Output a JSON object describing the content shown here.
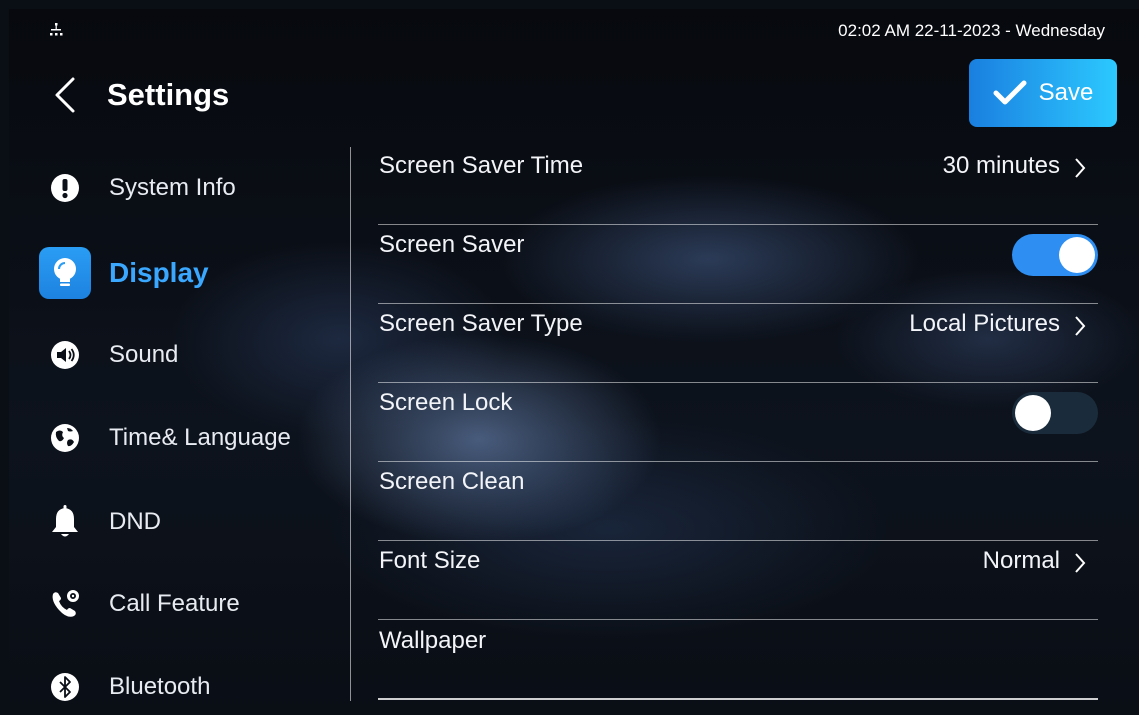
{
  "status_bar": {
    "datetime": "02:02 AM  22-11-2023 - Wednesday",
    "network_icon": "network-icon"
  },
  "header": {
    "title": "Settings",
    "back_icon": "chevron-left-icon",
    "save_label": "Save",
    "save_icon": "checkmark-icon"
  },
  "colors": {
    "accent": "#2f8ef2",
    "save_gradient_start": "#1a7fe0",
    "save_gradient_end": "#2cc9ff",
    "active_nav": "#3aa8ff"
  },
  "sidebar": {
    "items": [
      {
        "label": "System Info",
        "icon": "exclamation-icon",
        "active": false
      },
      {
        "label": "Display",
        "icon": "lightbulb-icon",
        "active": true
      },
      {
        "label": "Sound",
        "icon": "speaker-icon",
        "active": false
      },
      {
        "label": "Time& Language",
        "icon": "globe-icon",
        "active": false
      },
      {
        "label": "DND",
        "icon": "bell-icon",
        "active": false
      },
      {
        "label": "Call Feature",
        "icon": "phone-gear-icon",
        "active": false
      },
      {
        "label": "Bluetooth",
        "icon": "bluetooth-icon",
        "active": false
      }
    ]
  },
  "settings": {
    "rows": [
      {
        "label": "Screen Saver Time",
        "value": "30 minutes",
        "type": "link"
      },
      {
        "label": "Screen Saver",
        "type": "toggle",
        "on": true
      },
      {
        "label": "Screen Saver Type",
        "value": "Local Pictures",
        "type": "link"
      },
      {
        "label": "Screen Lock",
        "type": "toggle",
        "on": false
      },
      {
        "label": "Screen Clean",
        "type": "plain"
      },
      {
        "label": "Font Size",
        "value": "Normal",
        "type": "link"
      },
      {
        "label": "Wallpaper",
        "type": "plain"
      }
    ]
  }
}
